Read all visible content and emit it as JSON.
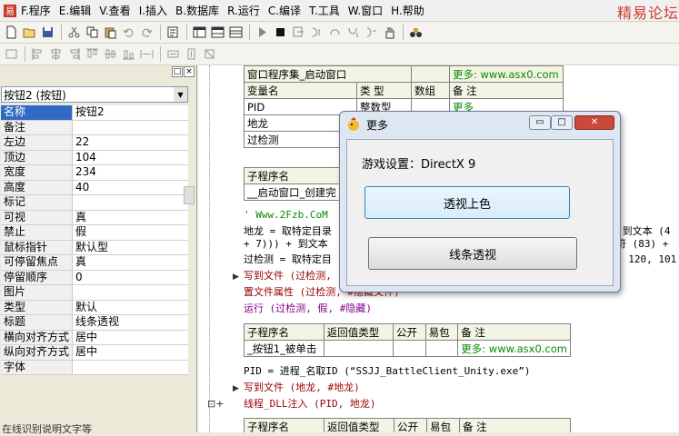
{
  "menubar": {
    "items": [
      "F.程序",
      "E.编辑",
      "V.查看",
      "I.插入",
      "B.数据库",
      "R.运行",
      "C.编译",
      "T.工具",
      "W.窗口",
      "H.帮助"
    ],
    "brand": "精易论坛"
  },
  "panel": {
    "pin_label": "□",
    "close_label": "×",
    "selected_object": "按钮2 (按钮)",
    "properties": [
      {
        "name": "名称",
        "value": "按钮2"
      },
      {
        "name": "备注",
        "value": ""
      },
      {
        "name": "左边",
        "value": "22"
      },
      {
        "name": "顶边",
        "value": "104"
      },
      {
        "name": "宽度",
        "value": "234"
      },
      {
        "name": "高度",
        "value": "40"
      },
      {
        "name": "标记",
        "value": ""
      },
      {
        "name": "可视",
        "value": "真"
      },
      {
        "name": "禁止",
        "value": "假"
      },
      {
        "name": "鼠标指针",
        "value": "默认型"
      },
      {
        "name": "可停留焦点",
        "value": "真"
      },
      {
        "name": "  停留顺序",
        "value": "0"
      },
      {
        "name": "图片",
        "value": ""
      },
      {
        "name": "类型",
        "value": "默认"
      },
      {
        "name": "标题",
        "value": "线条透视"
      },
      {
        "name": "横向对齐方式",
        "value": "居中"
      },
      {
        "name": "纵向对齐方式",
        "value": "居中"
      },
      {
        "name": "字体",
        "value": ""
      }
    ],
    "bottom_text": "在线识别说明文字等"
  },
  "editor": {
    "table1": {
      "name": "窗口程序集_启动窗口",
      "more": "更多: www.asx0.com",
      "headers": [
        "变量名",
        "类 型",
        "数组",
        "备 注"
      ],
      "rows": [
        [
          "PID",
          "整数型",
          "",
          "更多"
        ],
        [
          "地龙",
          "",
          "",
          ""
        ],
        [
          "过检测",
          "",
          "",
          ""
        ]
      ]
    },
    "table2": {
      "header": "子程序名",
      "row": "__启动窗口_创建完"
    },
    "lines": [
      "' Www.2Fzb.CoM",
      "地龙 = 取特定目录",
      "+ 7))) + 到文本",
      "过检测 = 取特定目",
      "写到文件 (过检测,",
      "置文件属性 (过检测, #隐藏文件)",
      "运行 (过检测, 假, #隐藏)"
    ],
    "right_fragments": [
      "(到文本 (4",
      "符 (83) +",
      ", 120, 101"
    ],
    "table3": {
      "headers": [
        "子程序名",
        "返回值类型",
        "公开",
        "易包",
        "备 注"
      ],
      "row": [
        "_按钮1_被单击",
        "",
        "",
        "",
        "更多: www.asx0.com"
      ]
    },
    "lines2": [
      "PID = 进程_名取ID (“SSJJ_BattleClient_Unity.exe”)",
      "写到文件 (地龙, #地龙)",
      "线程_DLL注入 (PID, 地龙)"
    ],
    "table4_headers": [
      "子程序名",
      "返回值类型",
      "公开",
      "易包",
      "备 注"
    ]
  },
  "dialog": {
    "title": "更多",
    "game_label": "游戏设置：DirectX 9",
    "button1": "透视上色",
    "button2": "线条透视",
    "min_label": "▭",
    "max_label": "□",
    "close_label": "✕"
  }
}
